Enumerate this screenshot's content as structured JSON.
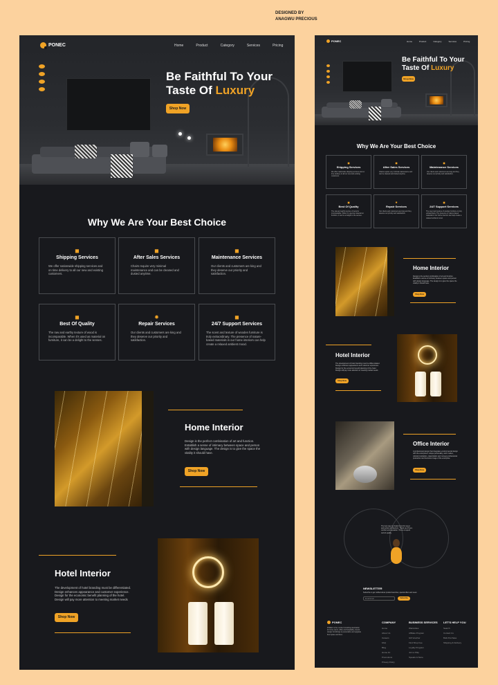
{
  "credit": {
    "line1": "DESIGNED BY",
    "line2": "ANAGWU PRECIOUS"
  },
  "brand": {
    "name": "PONEC",
    "accent": "#f0a326",
    "background": "#18191d",
    "canvas": "#fcd29e"
  },
  "nav": [
    "Home",
    "Product",
    "Category",
    "Services",
    "Pricing"
  ],
  "hero": {
    "title_line1": "Be Faithful To Your",
    "title_line2_prefix": "Taste Of",
    "title_highlight": "Luxury",
    "cta": "Shop Now"
  },
  "why": {
    "title": "Why We Are Your Best Choice",
    "cards": [
      {
        "icon": "truck-icon",
        "title": "Shipping Services",
        "desc": "We offer nationwide shipping services and on time delivery to all our new and existing customers."
      },
      {
        "icon": "service-icon",
        "title": "After Sales Services",
        "desc": "Chairs require very minimal maintenance and can be cleaned and dusted anytime."
      },
      {
        "icon": "tools-icon",
        "title": "Maintenance Services",
        "desc": "Our clients and customers are king and they deserve our priority and satisfaction."
      },
      {
        "icon": "quality-icon",
        "title": "Best Of Quality",
        "desc": "The raw and earthy texture of wood is incomparable. When it's used as material on furniture, it can be a delight to the senses."
      },
      {
        "icon": "gear-icon",
        "title": "Repair Services",
        "desc": "Our clients and customers are king and they deserve our priority and satisfaction."
      },
      {
        "icon": "support-icon",
        "title": "24/7 Support Services",
        "desc": "The scent and texture of wooden furniture is truly extraordinary. The presence of nature-based materials in our home interiors can help create a relaxed ambient mood."
      }
    ]
  },
  "home": {
    "title": "Home Interior",
    "desc": "Design is the perfect combination of art and function. Establish a sense of intimacy between space and person with design language. The design is to give the space the vitality it should have.",
    "cta": "Shop Now"
  },
  "hotel": {
    "title": "Hotel Interior",
    "desc": "The development of hotel branding must be differentiated. Design enhances appearance and customer experience. Design for the economic benefit planning of the hotel. Design will pay more attention to meeting market needs",
    "cta": "Shop Now"
  },
  "office": {
    "title": "Office Interior",
    "desc": "A professional design that integrates environmental design with the enterprise's unique personality, work modes, cultural inspiration, organization and conveys professional production and business image of the enterprise.",
    "cta": "Shop Now"
  },
  "testimonial": {
    "quote": "The best way we finally found for sweet and perfect architecture. Thank you Ponec, comfort and reputation. This is a superb work & quality."
  },
  "newsletter": {
    "title": "NEWSLETTER",
    "desc": "Subscribe to get notified about product launches, special offers and news.",
    "placeholder": "Email Email",
    "cta": "Subscribe"
  },
  "footer": {
    "about": "PONEC is the number furnishing destination for home decor, office and hospitality, interior design furnishings to personalize and upgrade their space and lives.",
    "columns": [
      {
        "title": "COMPANY",
        "items": [
          "Home",
          "About Us",
          "Careers",
          "FAQ",
          "Blog",
          "Home Int",
          "Promotions",
          "Privacy Policy"
        ]
      },
      {
        "title": "BUSINESS SERVICES",
        "items": [
          "Warranties",
          "Affiliate Program",
          "Gift Voucher",
          "Find Shop Fee",
          "Loyalty Program",
          "Join a Ship",
          "Speaks & Store"
        ]
      },
      {
        "title": "LET'S HELP YOU",
        "items": [
          "Search",
          "Contact Us",
          "Bulk Purchase",
          "Shipping & Delivery"
        ]
      }
    ]
  }
}
